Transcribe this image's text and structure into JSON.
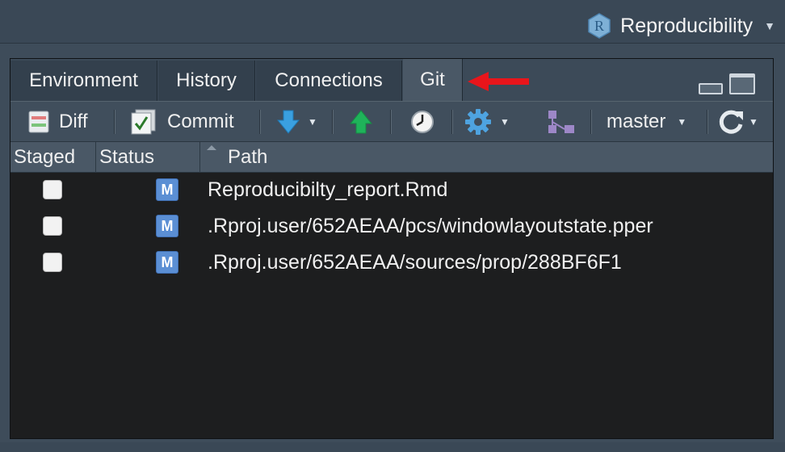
{
  "project": {
    "name": "Reproducibility",
    "logo_letter": "R"
  },
  "tabs": [
    {
      "label": "Environment",
      "active": false
    },
    {
      "label": "History",
      "active": false
    },
    {
      "label": "Connections",
      "active": false
    },
    {
      "label": "Git",
      "active": true
    }
  ],
  "toolbar": {
    "diff_label": "Diff",
    "commit_label": "Commit",
    "branch_label": "master"
  },
  "columns": {
    "staged": "Staged",
    "status": "Status",
    "path": "Path"
  },
  "files": [
    {
      "staged": false,
      "status": "M",
      "path": "Reproducibilty_report.Rmd"
    },
    {
      "staged": false,
      "status": "M",
      "path": ".Rproj.user/652AEAA/pcs/windowlayoutstate.pper"
    },
    {
      "staged": false,
      "status": "M",
      "path": ".Rproj.user/652AEAA/sources/prop/288BF6F1"
    }
  ],
  "colors": {
    "annotation_arrow": "#e8151b",
    "modified_badge": "#5b8fd4",
    "push_arrow": "#1fb35a",
    "pull_arrow": "#3aa0e0"
  },
  "icons": [
    "r-project-icon",
    "diff-icon",
    "commit-icon",
    "pull-icon",
    "push-icon",
    "history-icon",
    "gear-icon",
    "branch-icon",
    "refresh-icon",
    "minimize-icon",
    "maximize-icon",
    "red-arrow-icon"
  ]
}
